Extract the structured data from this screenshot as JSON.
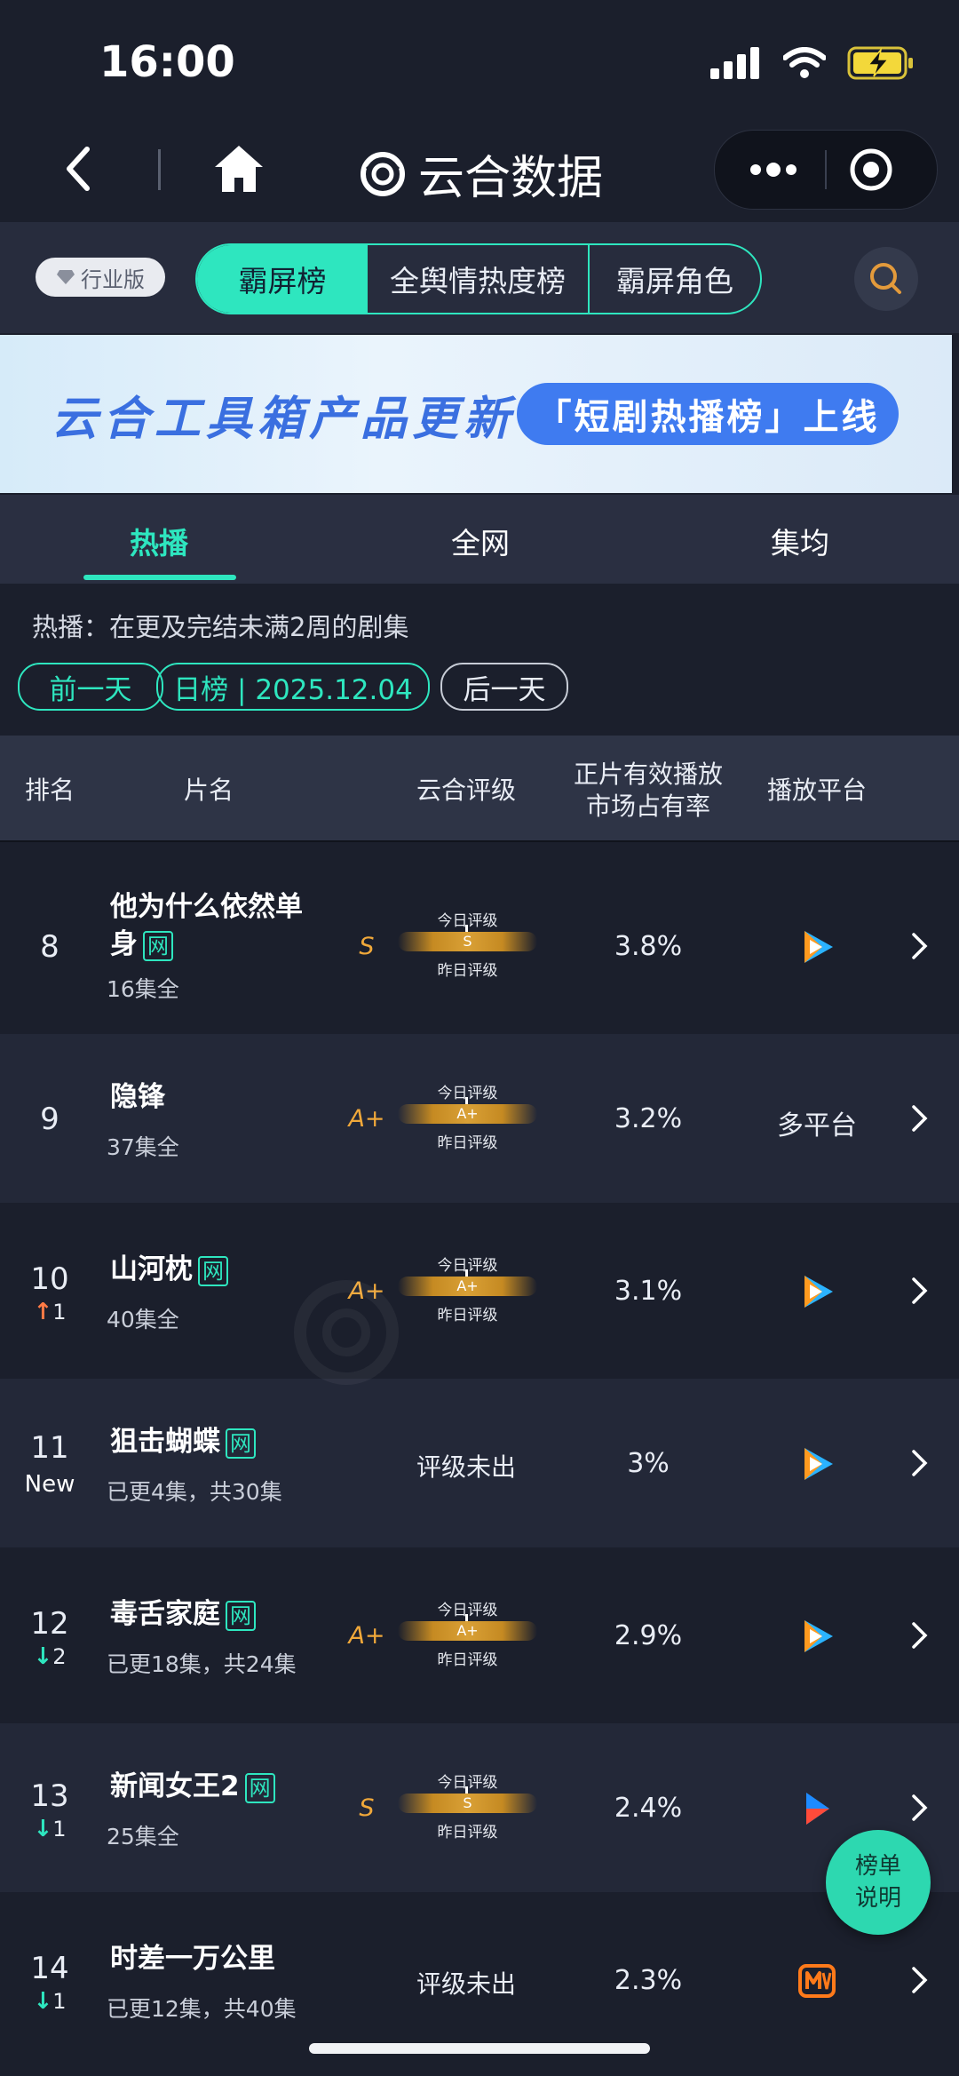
{
  "status": {
    "time": "16:00"
  },
  "nav": {
    "title": "云合数据"
  },
  "topbar": {
    "industry_label": "行业版",
    "segments": [
      "霸屏榜",
      "全舆情热度榜",
      "霸屏角色"
    ]
  },
  "banner": {
    "headline": "云合工具箱产品更新",
    "pill": "「短剧热播榜」上线"
  },
  "tabs": [
    "热播",
    "全网",
    "集均"
  ],
  "description": "热播：在更及完结未满2周的剧集",
  "date_controls": {
    "prev": "前一天",
    "current": "日榜 | 2025.12.04",
    "next": "后一天"
  },
  "table": {
    "headers": {
      "rank": "排名",
      "title": "片名",
      "grade": "云合评级",
      "share_line1": "正片有效播放",
      "share_line2": "市场占有率",
      "platform": "播放平台"
    },
    "rating_labels": {
      "today": "今日评级",
      "yesterday": "昨日评级"
    },
    "no_grade_text": "评级未出",
    "rows": [
      {
        "rank": "8",
        "change": "",
        "title_line1": "他为什么依然单",
        "title_line2": "身",
        "web": "网",
        "episodes": "16集全",
        "grade": "S",
        "bar_grade": "S",
        "share": "3.8%",
        "platform": "",
        "platform_icon": "tencent-video-icon"
      },
      {
        "rank": "9",
        "change": "",
        "title_line1": "隐锋",
        "title_line2": "",
        "web": "",
        "episodes": "37集全",
        "grade": "A+",
        "bar_grade": "A+",
        "share": "3.2%",
        "platform": "多平台",
        "platform_icon": ""
      },
      {
        "rank": "10",
        "change": "1",
        "title_line1": "山河枕",
        "title_line2": "",
        "web": "网",
        "episodes": "40集全",
        "grade": "A+",
        "bar_grade": "A+",
        "share": "3.1%",
        "platform": "",
        "platform_icon": "tencent-video-icon"
      },
      {
        "rank": "11",
        "change": "New",
        "title_line1": "狙击蝴蝶",
        "title_line2": "",
        "web": "网",
        "episodes": "已更4集，共30集",
        "grade": "",
        "bar_grade": "",
        "share": "3%",
        "platform": "",
        "platform_icon": "tencent-video-icon"
      },
      {
        "rank": "12",
        "change": "2",
        "title_line1": "毒舌家庭",
        "title_line2": "",
        "web": "网",
        "episodes": "已更18集，共24集",
        "grade": "A+",
        "bar_grade": "A+",
        "share": "2.9%",
        "platform": "",
        "platform_icon": "tencent-video-icon"
      },
      {
        "rank": "13",
        "change": "1",
        "title_line1": "新闻女王2",
        "title_line2": "",
        "web": "网",
        "episodes": "25集全",
        "grade": "S",
        "bar_grade": "S",
        "share": "2.4%",
        "platform": "",
        "platform_icon": "youku-icon"
      },
      {
        "rank": "14",
        "change": "1",
        "title_line1": "时差一万公里",
        "title_line2": "",
        "web": "",
        "episodes": "已更12集，共40集",
        "grade": "",
        "bar_grade": "",
        "share": "2.3%",
        "platform": "",
        "platform_icon": "mango-tv-icon"
      }
    ]
  },
  "fab": {
    "line1": "榜单",
    "line2": "说明"
  },
  "colors": {
    "accent": "#2ee6bf",
    "background": "#1b1f2c",
    "grade": "#f0a83a",
    "up": "#ff7a45"
  }
}
